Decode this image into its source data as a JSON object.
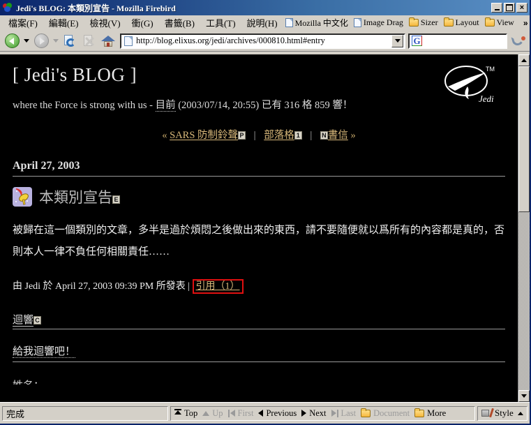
{
  "window": {
    "title": "Jedi's BLOG: 本類別宣告 - Mozilla Firebird",
    "app_icon": "firebird-icon",
    "minimize_label": "_",
    "maximize_label": "□",
    "close_label": "×"
  },
  "menubar": {
    "items": [
      {
        "label": "檔案(F)",
        "name": "menu-file"
      },
      {
        "label": "編輯(E)",
        "name": "menu-edit"
      },
      {
        "label": "檢視(V)",
        "name": "menu-view"
      },
      {
        "label": "衝(G)",
        "name": "menu-go"
      },
      {
        "label": "書籤(B)",
        "name": "menu-bookmarks"
      },
      {
        "label": "工具(T)",
        "name": "menu-tools"
      },
      {
        "label": "說明(H)",
        "name": "menu-help"
      }
    ]
  },
  "bookmarkbar": {
    "items": [
      {
        "label": "Mozilla 中文化",
        "icon": "document-icon"
      },
      {
        "label": "Image Drag",
        "icon": "document-icon"
      },
      {
        "label": "Sizer",
        "icon": "folder-icon"
      },
      {
        "label": "Layout",
        "icon": "folder-icon"
      },
      {
        "label": "View",
        "icon": "folder-icon"
      }
    ],
    "overflow_label": "»"
  },
  "navbar": {
    "back_title": "Back",
    "forward_title": "Forward",
    "reload_title": "Reload",
    "stop_title": "Stop",
    "home_title": "Home",
    "url": "http://blog.elixus.org/jedi/archives/000810.html#entry",
    "url_placeholder": "",
    "search_value": "",
    "search_placeholder": "",
    "search_engine_letter": "G"
  },
  "page": {
    "blog_title": "[ Jedi's BLOG ]",
    "tagline_prefix": "where the Force is strong with us - ",
    "tagline_link": "目前",
    "tagline_suffix": " (2003/07/14, 20:55) 已有 316 格 859 響！",
    "logo_text": "Jedi",
    "logo_tm": "TM",
    "nav": {
      "prev_arrow": "«",
      "prev_label": "SARS 防制鈴聲",
      "prev_key": "P",
      "sep": "|",
      "mid_label": "部落格",
      "mid_key": "1",
      "next_key": "N",
      "next_label": "書信",
      "next_arrow": "»"
    },
    "date_heading": "April 27, 2003",
    "entry": {
      "icon": "satellite-dish-icon",
      "title": "本類別宣告",
      "title_key": "E",
      "body": "被歸在這一個類別的文章，多半是過於煩悶之後做出來的東西，請不要隨便就以爲所有的內容都是真的，否則本人一律不負任何相關責任……",
      "byline": "由 Jedi 於 April 27, 2003 09:39 PM 所發表 |",
      "cite_link": "引用（1）"
    },
    "comments_heading": "迴響",
    "comments_key": "C",
    "comment_invite": "給我迴響吧！",
    "cut_off_text": "姓名："
  },
  "statusbar": {
    "message": "完成",
    "nav_items": [
      {
        "label": "Top",
        "icon": "top-icon",
        "enabled": true
      },
      {
        "label": "Up",
        "icon": "up-arrow-icon",
        "enabled": false
      },
      {
        "label": "First",
        "icon": "first-icon",
        "enabled": false
      },
      {
        "label": "Previous",
        "icon": "prev-arrow-icon",
        "enabled": true
      },
      {
        "label": "Next",
        "icon": "next-arrow-icon",
        "enabled": true
      },
      {
        "label": "Last",
        "icon": "last-icon",
        "enabled": false
      },
      {
        "label": "Document",
        "icon": "folder-icon",
        "enabled": false
      },
      {
        "label": "More",
        "icon": "folder-icon",
        "enabled": true
      }
    ],
    "style_label": "Style",
    "style_caret": "▲"
  },
  "colors": {
    "titlebar_start": "#0a246a",
    "chrome": "#d4d0c8",
    "page_bg": "#000000",
    "page_fg": "#ffffff",
    "link": "#d8b87a",
    "focus_outline": "#e01010"
  }
}
